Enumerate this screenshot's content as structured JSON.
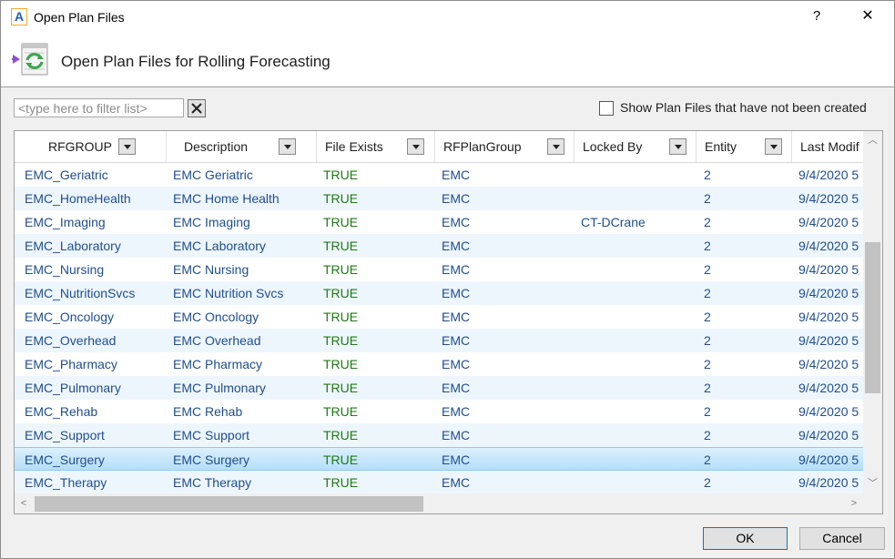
{
  "window": {
    "app_icon_letter": "A",
    "title": "Open Plan Files",
    "help_label": "?",
    "close_label": "✕"
  },
  "header": {
    "title": "Open Plan Files for Rolling Forecasting",
    "icon": "plan-files-refresh-icon"
  },
  "filter": {
    "placeholder": "<type here to filter list>",
    "value": "",
    "clear_icon": "close-icon"
  },
  "show_uncreated": {
    "label": "Show Plan Files that have not been created",
    "checked": false
  },
  "grid": {
    "columns": [
      "RFGROUP",
      "Description",
      "File Exists",
      "RFPlanGroup",
      "Locked By",
      "Entity",
      "Last Modif"
    ],
    "rows": [
      [
        "EMC_Geriatric",
        "EMC Geriatric",
        "TRUE",
        "EMC",
        "",
        "2",
        "9/4/2020 5"
      ],
      [
        "EMC_HomeHealth",
        "EMC Home Health",
        "TRUE",
        "EMC",
        "",
        "2",
        "9/4/2020 5"
      ],
      [
        "EMC_Imaging",
        "EMC Imaging",
        "TRUE",
        "EMC",
        "CT-DCrane",
        "2",
        "9/4/2020 5"
      ],
      [
        "EMC_Laboratory",
        "EMC Laboratory",
        "TRUE",
        "EMC",
        "",
        "2",
        "9/4/2020 5"
      ],
      [
        "EMC_Nursing",
        "EMC Nursing",
        "TRUE",
        "EMC",
        "",
        "2",
        "9/4/2020 5"
      ],
      [
        "EMC_NutritionSvcs",
        "EMC Nutrition Svcs",
        "TRUE",
        "EMC",
        "",
        "2",
        "9/4/2020 5"
      ],
      [
        "EMC_Oncology",
        "EMC Oncology",
        "TRUE",
        "EMC",
        "",
        "2",
        "9/4/2020 5"
      ],
      [
        "EMC_Overhead",
        "EMC Overhead",
        "TRUE",
        "EMC",
        "",
        "2",
        "9/4/2020 5"
      ],
      [
        "EMC_Pharmacy",
        "EMC Pharmacy",
        "TRUE",
        "EMC",
        "",
        "2",
        "9/4/2020 5"
      ],
      [
        "EMC_Pulmonary",
        "EMC Pulmonary",
        "TRUE",
        "EMC",
        "",
        "2",
        "9/4/2020 5"
      ],
      [
        "EMC_Rehab",
        "EMC Rehab",
        "TRUE",
        "EMC",
        "",
        "2",
        "9/4/2020 5"
      ],
      [
        "EMC_Support",
        "EMC Support",
        "TRUE",
        "EMC",
        "",
        "2",
        "9/4/2020 5"
      ],
      [
        "EMC_Surgery",
        "EMC Surgery",
        "TRUE",
        "EMC",
        "",
        "2",
        "9/4/2020 5"
      ],
      [
        "EMC_Therapy",
        "EMC Therapy",
        "TRUE",
        "EMC",
        "",
        "2",
        "9/4/2020 5"
      ]
    ],
    "selected_row": 12
  },
  "buttons": {
    "ok_label": "OK",
    "cancel_label": "Cancel"
  },
  "colors": {
    "link_text": "#1f4e8c",
    "true_text": "#1e7a14",
    "selection": "#b5defa",
    "alt_row": "#eef6fd"
  }
}
